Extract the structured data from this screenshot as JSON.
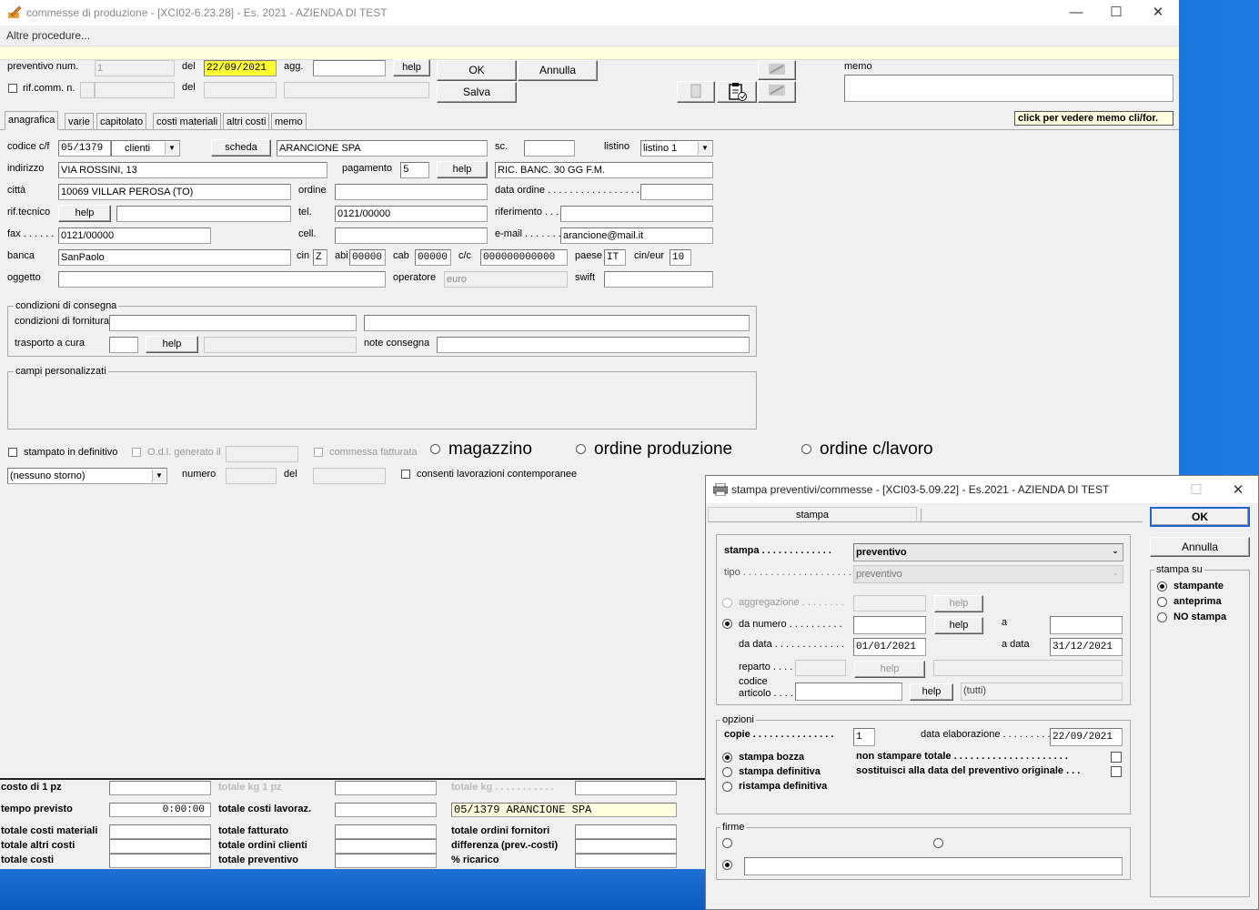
{
  "main_window": {
    "title": "commesse di produzione - [XCI02-6.23.28] - Es. 2021 - AZIENDA DI TEST",
    "menu": "Altre procedure...",
    "controls": {
      "minimize": "—",
      "maximize": "☐",
      "close": "✕"
    }
  },
  "header": {
    "preventivo_label": "preventivo num.",
    "preventivo_value": "1",
    "del_label": "del",
    "del_value": "22/09/2021",
    "agg_label": "agg.",
    "help_label": "help",
    "rif_comm_label": "rif.comm. n.",
    "del2_label": "del",
    "ok_label": "OK",
    "annulla_label": "Annulla",
    "salva_label": "Salva",
    "memo_label": "memo",
    "memo_hint": "click per vedere memo cli/for."
  },
  "tabs": [
    "anagrafica",
    "varie",
    "capitolato",
    "costi materiali",
    "altri costi",
    "memo"
  ],
  "anagrafica": {
    "codice_label": "codice c/f",
    "codice_value": "05/1379",
    "clienti": "clienti",
    "scheda": "scheda",
    "ragione_sociale": "ARANCIONE SPA",
    "sc_label": "sc.",
    "listino_label": "listino",
    "listino_value": "listino 1",
    "indirizzo_label": "indirizzo",
    "indirizzo_value": "VIA ROSSINI, 13",
    "pagamento_label": "pagamento",
    "pagamento_code": "5",
    "help": "help",
    "pagamento_desc": "RIC. BANC. 30 GG F.M.",
    "citta_label": "città",
    "citta_value": "10069 VILLAR PEROSA (TO)",
    "ordine_label": "ordine",
    "data_ordine_label": "data ordine . . . . . . . . . . . . . . . . .",
    "rif_tecnico_label": "rif.tecnico",
    "tel_label": "tel.",
    "tel_value": "0121/00000",
    "riferimento_label": "riferimento . . . .",
    "fax_label": "fax . . . . . .",
    "fax_value": "0121/00000",
    "cell_label": "cell.",
    "email_label": "e-mail . . . . . . . .",
    "email_value": "arancione@mail.it",
    "banca_label": "banca",
    "banca_value": "SanPaolo",
    "cin_label": "cin",
    "cin_value": "Z",
    "abi_label": "abi",
    "abi_value": "00000",
    "cab_label": "cab",
    "cab_value": "00000",
    "cc_label": "c/c",
    "cc_value": "000000000000",
    "paese_label": "paese",
    "paese_value": "IT",
    "cineur_label": "cin/eur",
    "cineur_value": "10",
    "oggetto_label": "oggetto",
    "operatore_label": "operatore",
    "operatore_value": "euro",
    "swift_label": "swift"
  },
  "consegna": {
    "title": "condizioni di consegna",
    "fornitura_label": "condizioni di fornitura",
    "trasporto_label": "trasporto a cura",
    "help": "help",
    "note_label": "note consegna"
  },
  "campi": {
    "title": "campi personalizzati"
  },
  "options": {
    "stampato_label": "stampato in definitivo",
    "odl_label": "O.d.l. generato il",
    "commessa_label": "commessa fatturata",
    "magazzino": "magazzino",
    "ordine_produzione": "ordine produzione",
    "ordine_clavoro": "ordine c/lavoro",
    "storno_value": "(nessuno storno)",
    "numero_label": "numero",
    "del_label": "del",
    "consenti_label": "consenti lavorazioni contemporanee"
  },
  "totals": {
    "costo_1pz": "costo di 1 pz",
    "totale_kg_1pz": "totale kg 1 pz",
    "totale_kg": "totale kg . . . . . . . . . . .",
    "tempo_previsto": "tempo previsto",
    "tempo_value": "0:00:00",
    "totale_costi_lavoraz": "totale costi lavoraz.",
    "cliente_value": "05/1379 ARANCIONE SPA",
    "totale_costi_materiali": "totale costi materiali",
    "totale_fatturato": "totale fatturato",
    "totale_ordini_fornitori": "totale ordini fornitori",
    "totale_altri_costi": "totale altri costi",
    "totale_ordini_clienti": "totale ordini clienti",
    "differenza": "differenza (prev.-costi)",
    "totale_costi": "totale costi",
    "totale_preventivo": "totale preventivo",
    "ricarico": "% ricarico"
  },
  "dialog": {
    "title": "stampa preventivi/commesse - [XCI03-5.09.22] - Es.2021 - AZIENDA DI TEST",
    "tab": "stampa",
    "ok": "OK",
    "annulla": "Annulla",
    "stampa_su": "stampa su",
    "stampante": "stampante",
    "anteprima": "anteprima",
    "no_stampa": "NO stampa",
    "stampa_label": "stampa . . . . . . . . . . . . .",
    "stampa_value": "preventivo",
    "tipo_label": "tipo . . . . . . . . . . . . . . . . . . . .",
    "tipo_value": "preventivo",
    "aggregazione_label": "aggregazione . . . . . . . .",
    "help": "help",
    "da_numero_label": "da numero . . . . . . . . . .",
    "a_label": "a",
    "da_data_label": "da data . . . . . . . . . . . . .",
    "da_data_value": "01/01/2021",
    "a_data_label": "a data",
    "a_data_value": "31/12/2021",
    "reparto_label": "reparto . . . .",
    "codice_label": "codice",
    "articolo_label": "articolo . . . .",
    "articolo_value": "(tutti)",
    "opzioni": "opzioni",
    "copie_label": "copie . . . . . . . . . . . . . . .",
    "copie_value": "1",
    "data_elab_label": "data elaborazione . . . . . . . . .",
    "data_elab_value": "22/09/2021",
    "stampa_bozza": "stampa bozza",
    "stampa_definitiva": "stampa definitiva",
    "ristampa_definitiva": "ristampa definitiva",
    "non_stampare_totale": "non stampare totale . . . . . . . . . . . . . . . . . . . . .",
    "sostituisci": "sostituisci alla data del preventivo originale . . .",
    "firme": "firme"
  }
}
